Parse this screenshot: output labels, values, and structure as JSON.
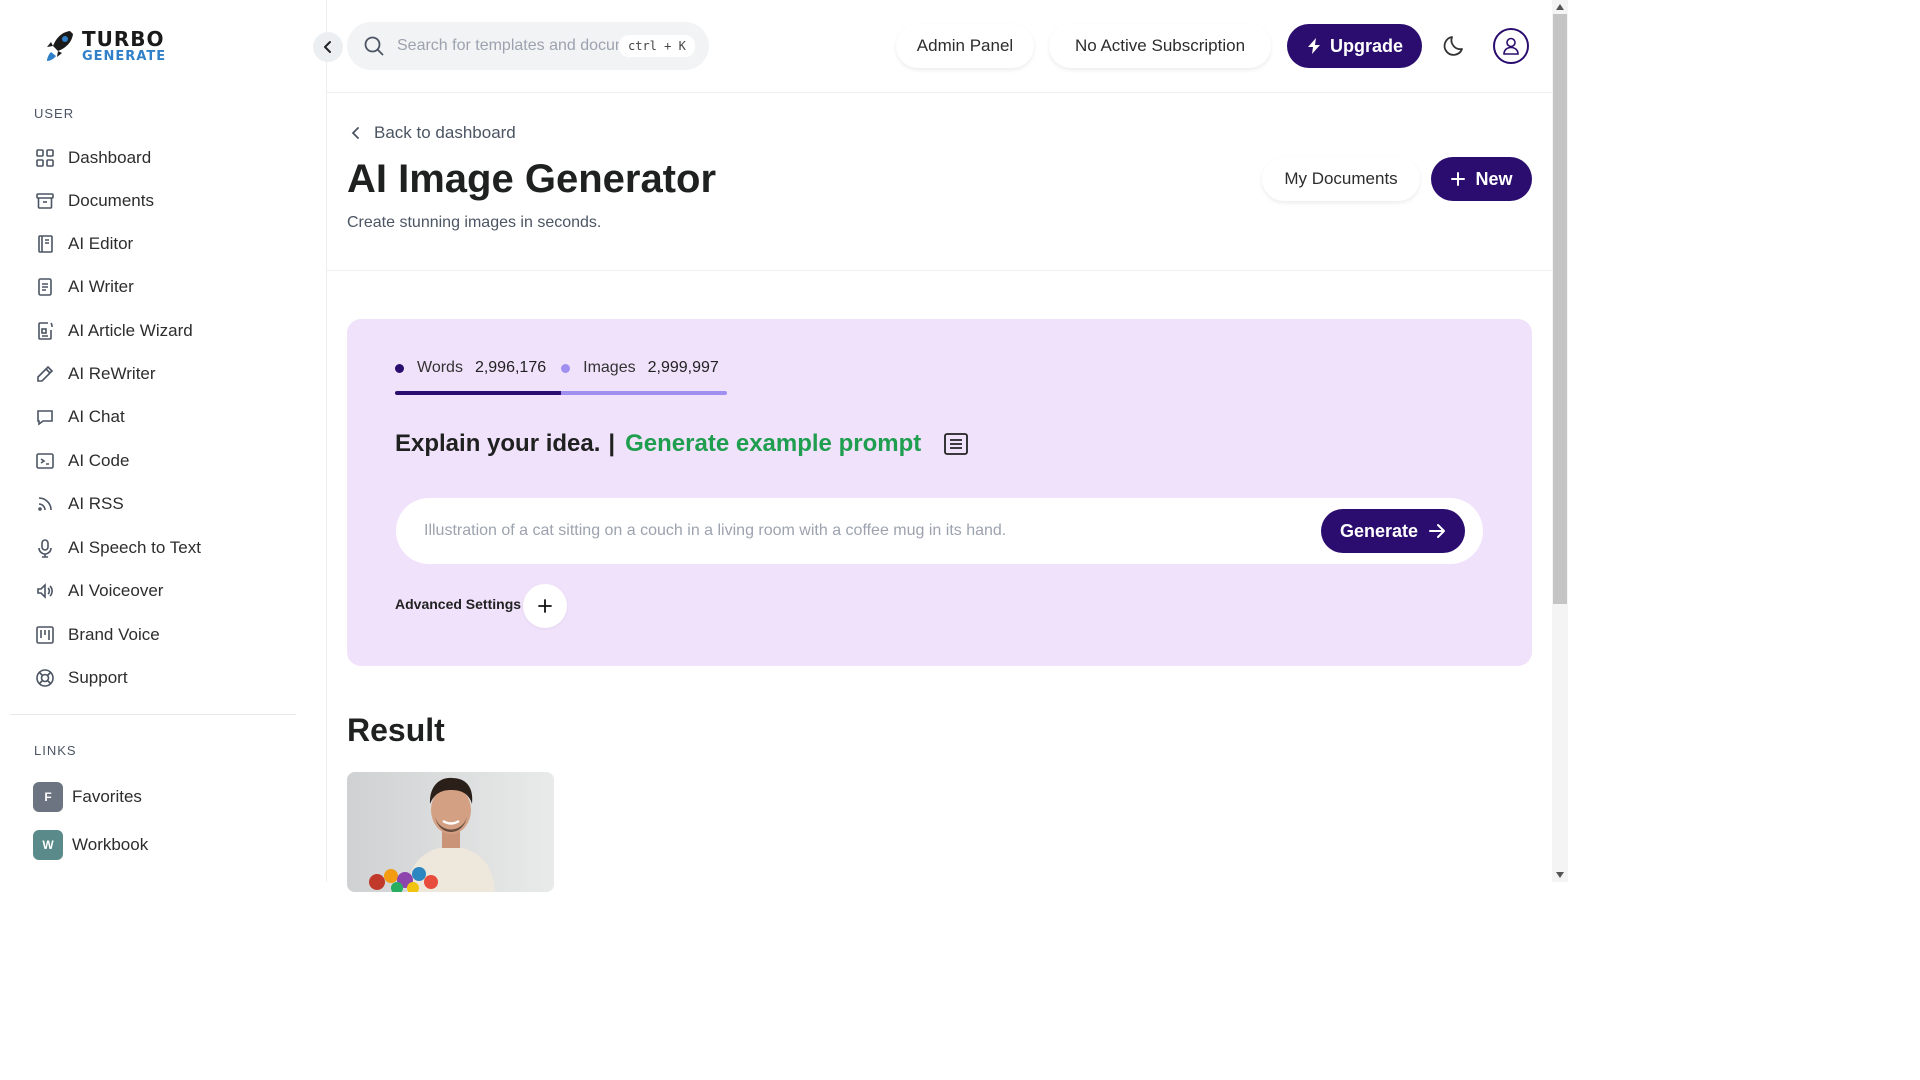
{
  "brand": {
    "line1": "TURBO",
    "line2": "GENERATE"
  },
  "sidebar": {
    "user_label": "USER",
    "items": [
      {
        "label": "Dashboard",
        "icon": "grid-icon"
      },
      {
        "label": "Documents",
        "icon": "archive-icon"
      },
      {
        "label": "AI Editor",
        "icon": "notebook-icon"
      },
      {
        "label": "AI Writer",
        "icon": "file-text-icon"
      },
      {
        "label": "AI Article Wizard",
        "icon": "article-wizard-icon"
      },
      {
        "label": "AI ReWriter",
        "icon": "pencil-icon"
      },
      {
        "label": "AI Chat",
        "icon": "chat-icon"
      },
      {
        "label": "AI Code",
        "icon": "terminal-icon"
      },
      {
        "label": "AI RSS",
        "icon": "rss-icon"
      },
      {
        "label": "AI Speech to Text",
        "icon": "microphone-icon"
      },
      {
        "label": "AI Voiceover",
        "icon": "speaker-icon"
      },
      {
        "label": "Brand Voice",
        "icon": "layout-board-icon"
      },
      {
        "label": "Support",
        "icon": "lifebuoy-icon"
      }
    ],
    "links_label": "LINKS",
    "links": [
      {
        "badge": "F",
        "label": "Favorites",
        "color": "#6b7480"
      },
      {
        "badge": "W",
        "label": "Workbook",
        "color": "#5b8a8a"
      }
    ]
  },
  "topbar": {
    "search_placeholder": "Search for templates and documents...",
    "shortcut": "ctrl + K",
    "admin_panel": "Admin Panel",
    "subscription": "No Active Subscription",
    "upgrade": "Upgrade"
  },
  "page": {
    "back": "Back to dashboard",
    "title": "AI Image Generator",
    "subtitle": "Create stunning images in seconds.",
    "my_documents": "My Documents",
    "new": "New"
  },
  "generator": {
    "words_label": "Words",
    "words_value": "2,996,176",
    "images_label": "Images",
    "images_value": "2,999,997",
    "words_share": 0.5,
    "idea": "Explain your idea.",
    "separator": "|",
    "example_prompt": "Generate example prompt",
    "prompt_placeholder": "Illustration of a cat sitting on a couch in a living room with a coffee mug in its hand.",
    "generate": "Generate",
    "advanced": "Advanced Settings"
  },
  "result": {
    "title": "Result"
  },
  "colors": {
    "primary": "#2a0d6e",
    "panel": "#f1e2fb",
    "words_dot": "#2a0d6e",
    "images_dot": "#9f8ff0",
    "accent_green": "#1e9e4e"
  }
}
